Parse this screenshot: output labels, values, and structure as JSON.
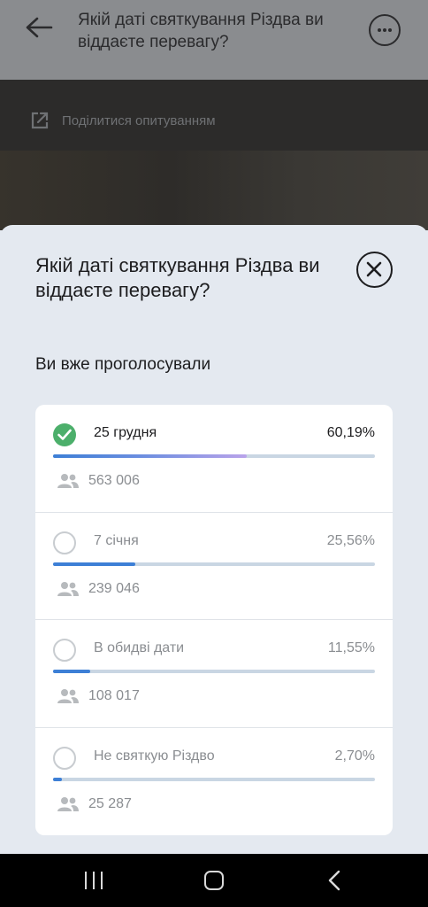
{
  "header": {
    "title": "Якій даті святкування Різдва ви віддаєте перевагу?",
    "back_icon": "arrow-left-icon",
    "more_icon": "more-dots-icon"
  },
  "share": {
    "label": "Поділитися опитуванням",
    "icon": "share-external-icon"
  },
  "sheet": {
    "title": "Якій даті святкування Різдва ви віддаєте перевагу?",
    "voted_text": "Ви вже проголосували",
    "close_icon": "close-icon"
  },
  "options": [
    {
      "label": "25 грудня",
      "percent_text": "60,19%",
      "percent": 60.19,
      "count": "563 006",
      "selected": true
    },
    {
      "label": "7 січня",
      "percent_text": "25,56%",
      "percent": 25.56,
      "count": "239 046",
      "selected": false
    },
    {
      "label": "В обидві дати",
      "percent_text": "11,55%",
      "percent": 11.55,
      "count": "108 017",
      "selected": false
    },
    {
      "label": "Не святкую Різдво",
      "percent_text": "2,70%",
      "percent": 2.7,
      "count": "25 287",
      "selected": false
    }
  ],
  "colors": {
    "selected_check": "#4caf6b",
    "bar": "#3d7fd6",
    "bar_track": "#c9d6e3"
  },
  "navbar": {
    "recents_icon": "recents-icon",
    "home_icon": "home-icon",
    "back_icon": "nav-back-icon"
  }
}
